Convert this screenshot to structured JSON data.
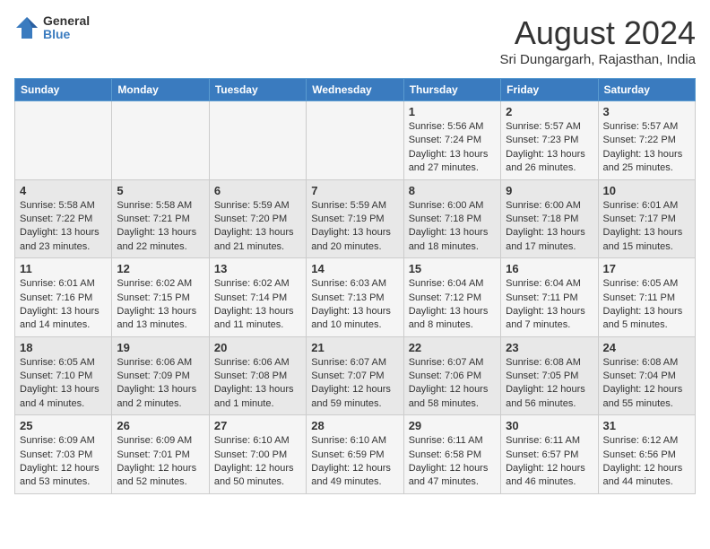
{
  "logo": {
    "general": "General",
    "blue": "Blue"
  },
  "title": "August 2024",
  "subtitle": "Sri Dungargarh, Rajasthan, India",
  "days_of_week": [
    "Sunday",
    "Monday",
    "Tuesday",
    "Wednesday",
    "Thursday",
    "Friday",
    "Saturday"
  ],
  "weeks": [
    [
      {
        "day": "",
        "info": ""
      },
      {
        "day": "",
        "info": ""
      },
      {
        "day": "",
        "info": ""
      },
      {
        "day": "",
        "info": ""
      },
      {
        "day": "1",
        "info": "Sunrise: 5:56 AM\nSunset: 7:24 PM\nDaylight: 13 hours and 27 minutes."
      },
      {
        "day": "2",
        "info": "Sunrise: 5:57 AM\nSunset: 7:23 PM\nDaylight: 13 hours and 26 minutes."
      },
      {
        "day": "3",
        "info": "Sunrise: 5:57 AM\nSunset: 7:22 PM\nDaylight: 13 hours and 25 minutes."
      }
    ],
    [
      {
        "day": "4",
        "info": "Sunrise: 5:58 AM\nSunset: 7:22 PM\nDaylight: 13 hours and 23 minutes."
      },
      {
        "day": "5",
        "info": "Sunrise: 5:58 AM\nSunset: 7:21 PM\nDaylight: 13 hours and 22 minutes."
      },
      {
        "day": "6",
        "info": "Sunrise: 5:59 AM\nSunset: 7:20 PM\nDaylight: 13 hours and 21 minutes."
      },
      {
        "day": "7",
        "info": "Sunrise: 5:59 AM\nSunset: 7:19 PM\nDaylight: 13 hours and 20 minutes."
      },
      {
        "day": "8",
        "info": "Sunrise: 6:00 AM\nSunset: 7:18 PM\nDaylight: 13 hours and 18 minutes."
      },
      {
        "day": "9",
        "info": "Sunrise: 6:00 AM\nSunset: 7:18 PM\nDaylight: 13 hours and 17 minutes."
      },
      {
        "day": "10",
        "info": "Sunrise: 6:01 AM\nSunset: 7:17 PM\nDaylight: 13 hours and 15 minutes."
      }
    ],
    [
      {
        "day": "11",
        "info": "Sunrise: 6:01 AM\nSunset: 7:16 PM\nDaylight: 13 hours and 14 minutes."
      },
      {
        "day": "12",
        "info": "Sunrise: 6:02 AM\nSunset: 7:15 PM\nDaylight: 13 hours and 13 minutes."
      },
      {
        "day": "13",
        "info": "Sunrise: 6:02 AM\nSunset: 7:14 PM\nDaylight: 13 hours and 11 minutes."
      },
      {
        "day": "14",
        "info": "Sunrise: 6:03 AM\nSunset: 7:13 PM\nDaylight: 13 hours and 10 minutes."
      },
      {
        "day": "15",
        "info": "Sunrise: 6:04 AM\nSunset: 7:12 PM\nDaylight: 13 hours and 8 minutes."
      },
      {
        "day": "16",
        "info": "Sunrise: 6:04 AM\nSunset: 7:11 PM\nDaylight: 13 hours and 7 minutes."
      },
      {
        "day": "17",
        "info": "Sunrise: 6:05 AM\nSunset: 7:11 PM\nDaylight: 13 hours and 5 minutes."
      }
    ],
    [
      {
        "day": "18",
        "info": "Sunrise: 6:05 AM\nSunset: 7:10 PM\nDaylight: 13 hours and 4 minutes."
      },
      {
        "day": "19",
        "info": "Sunrise: 6:06 AM\nSunset: 7:09 PM\nDaylight: 13 hours and 2 minutes."
      },
      {
        "day": "20",
        "info": "Sunrise: 6:06 AM\nSunset: 7:08 PM\nDaylight: 13 hours and 1 minute."
      },
      {
        "day": "21",
        "info": "Sunrise: 6:07 AM\nSunset: 7:07 PM\nDaylight: 12 hours and 59 minutes."
      },
      {
        "day": "22",
        "info": "Sunrise: 6:07 AM\nSunset: 7:06 PM\nDaylight: 12 hours and 58 minutes."
      },
      {
        "day": "23",
        "info": "Sunrise: 6:08 AM\nSunset: 7:05 PM\nDaylight: 12 hours and 56 minutes."
      },
      {
        "day": "24",
        "info": "Sunrise: 6:08 AM\nSunset: 7:04 PM\nDaylight: 12 hours and 55 minutes."
      }
    ],
    [
      {
        "day": "25",
        "info": "Sunrise: 6:09 AM\nSunset: 7:03 PM\nDaylight: 12 hours and 53 minutes."
      },
      {
        "day": "26",
        "info": "Sunrise: 6:09 AM\nSunset: 7:01 PM\nDaylight: 12 hours and 52 minutes."
      },
      {
        "day": "27",
        "info": "Sunrise: 6:10 AM\nSunset: 7:00 PM\nDaylight: 12 hours and 50 minutes."
      },
      {
        "day": "28",
        "info": "Sunrise: 6:10 AM\nSunset: 6:59 PM\nDaylight: 12 hours and 49 minutes."
      },
      {
        "day": "29",
        "info": "Sunrise: 6:11 AM\nSunset: 6:58 PM\nDaylight: 12 hours and 47 minutes."
      },
      {
        "day": "30",
        "info": "Sunrise: 6:11 AM\nSunset: 6:57 PM\nDaylight: 12 hours and 46 minutes."
      },
      {
        "day": "31",
        "info": "Sunrise: 6:12 AM\nSunset: 6:56 PM\nDaylight: 12 hours and 44 minutes."
      }
    ]
  ]
}
